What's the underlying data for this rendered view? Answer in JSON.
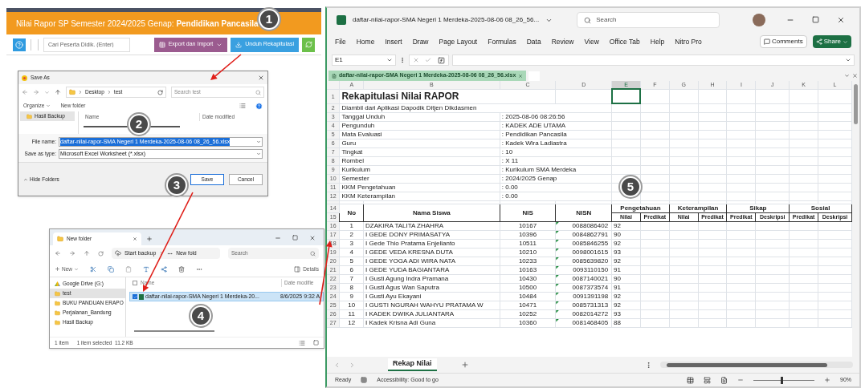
{
  "web_app": {
    "title": "Nilai Rapor SP Semester 2024/2025 Genap: **Pendidikan Pancasila**",
    "search_placeholder": "Cari Peserta Didik. (Enter)",
    "buttons": [
      {
        "label": "Export dan Import",
        "kind": "dropdown"
      },
      {
        "label": "Unduh Rekapitulasi",
        "kind": "download"
      }
    ]
  },
  "save_dialog": {
    "title": "Save As",
    "breadcrumb": [
      "Desktop",
      "test"
    ],
    "search_placeholder": "Search test",
    "toolbar": [
      "Organize",
      "New folder"
    ],
    "sidebar": [
      {
        "label": "Hasil Backup",
        "selected": true
      }
    ],
    "columns": [
      "Name",
      "Date modified"
    ],
    "fields": [
      {
        "label": "File name:",
        "value": "daftar-nilai-rapor-SMA Negeri 1 Merdeka-2025-08-06 08_26_56.xlsx",
        "selected": true
      },
      {
        "label": "Save as type:",
        "value": "Microsoft Excel Worksheet (*.xlsx)",
        "selected": false
      }
    ],
    "hide_folders": "Hide Folders",
    "buttons": [
      {
        "label": "Save",
        "primary": true
      },
      {
        "label": "Cancel",
        "primary": false
      }
    ]
  },
  "explorer": {
    "tab": "New folder",
    "breadcrumb": [
      "Start backup",
      "New fold"
    ],
    "search_placeholder": "Search",
    "new_label": "New",
    "details_label": "Details",
    "sidebar": [
      {
        "label": "Google Drive (G:)",
        "kind": "drive",
        "selected": false
      },
      {
        "label": "test",
        "kind": "folder",
        "selected": true
      },
      {
        "label": "BUKU PANDUAN ERAPO",
        "kind": "folder",
        "selected": false
      },
      {
        "label": "Perjalanan_Bandung",
        "kind": "folder",
        "selected": false
      },
      {
        "label": "Hasil Backup",
        "kind": "folder",
        "selected": false
      }
    ],
    "columns": [
      "Name",
      "Date modifie"
    ],
    "select_all": {
      "checked": false
    },
    "files": [
      {
        "name": "daftar-nilai-rapor-SMA Negeri 1 Merdeka-20...",
        "date": "8/6/2025 9:32 A",
        "selected": true,
        "checked": true
      }
    ],
    "status": [
      "1 item",
      "1 item selected  11.2 KB"
    ]
  },
  "excel": {
    "title": "daftar-nilai-rapor-SMA Negeri 1 Merdeka-2025-08-06 08_26_56...",
    "search_placeholder": "Search",
    "ribbon_tabs": [
      "File",
      "Home",
      "Insert",
      "Draw",
      "Page Layout",
      "Formulas",
      "Data",
      "Review",
      "View",
      "Office Tab",
      "Help",
      "Nitro Pro"
    ],
    "comments": "Comments",
    "share": "Share",
    "name_box": "E1",
    "doc_tab": "daftar-nilai-rapor-SMA Negeri 1 Merdeka-2025-08-06 08_26_56.xlsx",
    "columns": [
      {
        "label": "A",
        "selected": false
      },
      {
        "label": "B",
        "selected": false
      },
      {
        "label": "C",
        "selected": false
      },
      {
        "label": "D",
        "selected": false
      },
      {
        "label": "E",
        "selected": true
      },
      {
        "label": "F",
        "selected": false
      },
      {
        "label": "G",
        "selected": false
      },
      {
        "label": "H",
        "selected": false
      },
      {
        "label": "I",
        "selected": false
      },
      {
        "label": "J",
        "selected": false
      },
      {
        "label": "K",
        "selected": false
      },
      {
        "label": "L",
        "selected": false
      }
    ],
    "info_rows": [
      {
        "row": "1",
        "kind": "title",
        "text": "Rekapitulasi Nilai RAPOR"
      },
      {
        "row": "2",
        "kind": "note",
        "text": "Diambil dari Aplikasi Dapodik Ditjen Dikdasmen"
      },
      {
        "row": "3",
        "kind": "field",
        "label": "Tanggal Unduh",
        "value": ": 2025-08-06 08:26:56"
      },
      {
        "row": "4",
        "kind": "field",
        "label": "Pengunduh",
        "value": ": KADEK ADE UTAMA"
      },
      {
        "row": "5",
        "kind": "field",
        "label": "Mata Evaluasi",
        "value": ": Pendidikan Pancasila"
      },
      {
        "row": "6",
        "kind": "field",
        "label": "Guru",
        "value": ": Kadek Wira Ladiastra"
      },
      {
        "row": "7",
        "kind": "field",
        "label": "Tingkat",
        "value": ": 10"
      },
      {
        "row": "8",
        "kind": "field",
        "label": "Rombel",
        "value": ": X 11"
      },
      {
        "row": "9",
        "kind": "field",
        "label": "Kurikulum",
        "value": ": Kurikulum SMA Merdeka"
      },
      {
        "row": "10",
        "kind": "field",
        "label": "Semester",
        "value": ": 2024/2025 Genap"
      },
      {
        "row": "11",
        "kind": "field",
        "label": "KKM Pengetahuan",
        "value": ": 0.00"
      },
      {
        "row": "12",
        "kind": "field",
        "label": "KKM Keterampilan",
        "value": ": 0.00"
      }
    ],
    "header_rows": [
      "14",
      "15"
    ],
    "fixed_headers": [
      "No",
      "Nama Siswa",
      "NIS",
      "NISN"
    ],
    "groups": [
      {
        "label": "Pengetahuan",
        "subs": [
          "Nilai",
          "Predikat"
        ]
      },
      {
        "label": "Keterampilan",
        "subs": [
          "Nilai",
          "Predikat"
        ]
      },
      {
        "label": "Sikap",
        "subs": [
          "Predikat",
          "Deskripsi"
        ]
      },
      {
        "label": "Sosial",
        "subs": [
          "Predikat",
          "Deskripsi"
        ]
      }
    ],
    "students": [
      {
        "row": "16",
        "no": "1",
        "name": "DZAKIRA TALITA ZHAHRA",
        "nis": "10167",
        "nisn": "0088086402",
        "nilai": "92"
      },
      {
        "row": "17",
        "no": "2",
        "name": "I GEDE DONY PRIMASATYA",
        "nis": "10396",
        "nisn": "0084862791",
        "nilai": "90"
      },
      {
        "row": "18",
        "no": "3",
        "name": "I Gede Thio Pratama Enjelianto",
        "nis": "10511",
        "nisn": "0085846255",
        "nilai": "92"
      },
      {
        "row": "19",
        "no": "4",
        "name": "I GEDE VEDA KRESNA DUTA",
        "nis": "10210",
        "nisn": "0098001615",
        "nilai": "93"
      },
      {
        "row": "20",
        "no": "5",
        "name": "I GEDE YOGA ADI WIRA NATA",
        "nis": "10233",
        "nisn": "0085639820",
        "nilai": "92"
      },
      {
        "row": "21",
        "no": "6",
        "name": "I GEDE YUDA BAGIANTARA",
        "nis": "10163",
        "nisn": "0093110150",
        "nilai": "91"
      },
      {
        "row": "22",
        "no": "7",
        "name": "I Gusti Agung Indra Pramana",
        "nis": "10430",
        "nisn": "0087140021",
        "nilai": "90"
      },
      {
        "row": "23",
        "no": "8",
        "name": "I Gusti Agus Wan Saputra",
        "nis": "10500",
        "nisn": "0087373574",
        "nilai": "91"
      },
      {
        "row": "24",
        "no": "9",
        "name": "I Gusti Ayu Ekayani",
        "nis": "10484",
        "nisn": "0091391198",
        "nilai": "92"
      },
      {
        "row": "25",
        "no": "10",
        "name": "I GUSTI NGURAH WAHYU PRATAMA W",
        "nis": "10471",
        "nisn": "0085731313",
        "nilai": "92"
      },
      {
        "row": "26",
        "no": "11",
        "name": "I KADEK DWIKA JULIANTARA",
        "nis": "10252",
        "nisn": "0082014272",
        "nilai": "93"
      },
      {
        "row": "27",
        "no": "12",
        "name": "I Kadek Krisna Adi Guna",
        "nis": "10360",
        "nisn": "0081468405",
        "nilai": "88"
      }
    ],
    "sheet_tab": {
      "label": "Rekap Nilai",
      "selected": true
    },
    "status": "Ready",
    "accessibility": "Accessibility: Good to go",
    "zoom_slider": {
      "level": 0.45
    },
    "zoom": "90%"
  },
  "callouts": [
    "1",
    "2",
    "3",
    "4",
    "5"
  ]
}
